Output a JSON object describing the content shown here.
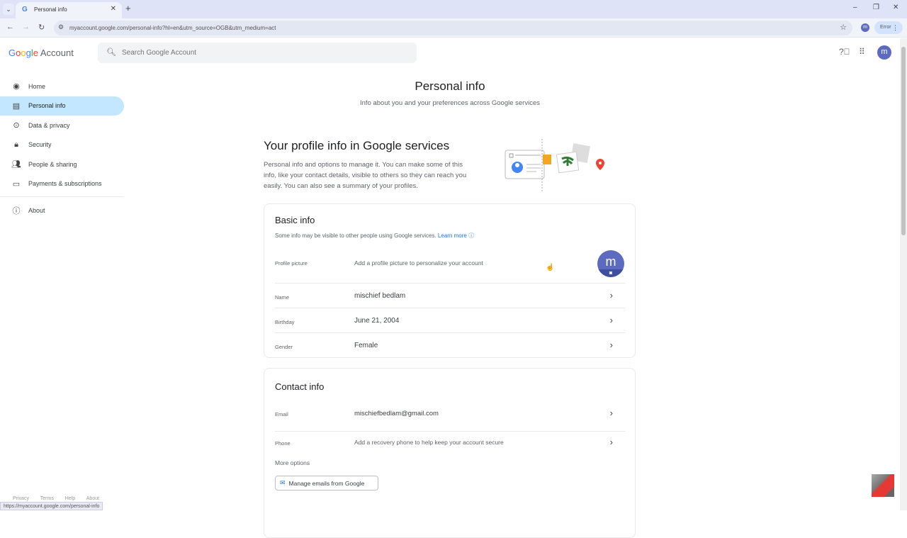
{
  "browser": {
    "tab_title": "Personal info",
    "url": "myaccount.google.com/personal-info?hl=en&utm_source=OGB&utm_medium=act",
    "profile_initial": "m",
    "error_label": "Error",
    "status_url": "https://myaccount.google.com/personal-info"
  },
  "header": {
    "logo_g": [
      "G",
      "o",
      "o",
      "g",
      "l",
      "e"
    ],
    "logo_account": "Account",
    "search_placeholder": "Search Google Account",
    "avatar_initial": "m"
  },
  "sidebar": {
    "items": [
      {
        "label": "Home",
        "icon": "account-circle-icon",
        "active": false
      },
      {
        "label": "Personal info",
        "icon": "id-card-icon",
        "active": true
      },
      {
        "label": "Data & privacy",
        "icon": "toggle-icon",
        "active": false
      },
      {
        "label": "Security",
        "icon": "lock-icon",
        "active": false
      },
      {
        "label": "People & sharing",
        "icon": "people-icon",
        "active": false
      },
      {
        "label": "Payments & subscriptions",
        "icon": "credit-card-icon",
        "active": false
      }
    ],
    "about": "About",
    "footer": [
      "Privacy",
      "Terms",
      "Help",
      "About"
    ]
  },
  "main": {
    "title": "Personal info",
    "subtitle": "Info about you and your preferences across Google services",
    "profile_heading": "Your profile info in Google services",
    "profile_desc": "Personal info and options to manage it. You can make some of this info, like your contact details, visible to others so they can reach you easily. You can also see a summary of your profiles."
  },
  "basic_info": {
    "title": "Basic info",
    "note": "Some info may be visible to other people using Google services.",
    "learn_more": "Learn more",
    "profile_picture_label": "Profile picture",
    "profile_picture_hint": "Add a profile picture to personalize your account",
    "profile_initial": "m",
    "rows": [
      {
        "label": "Name",
        "value": "mischief bedlam"
      },
      {
        "label": "Birthday",
        "value": "June 21, 2004"
      },
      {
        "label": "Gender",
        "value": "Female"
      }
    ]
  },
  "contact_info": {
    "title": "Contact info",
    "rows": [
      {
        "label": "Email",
        "value": "mischiefbedlam@gmail.com"
      },
      {
        "label": "Phone",
        "value": "Add a recovery phone to help keep your account secure"
      }
    ],
    "more_options": "More options",
    "manage_emails": "Manage emails from Google"
  }
}
